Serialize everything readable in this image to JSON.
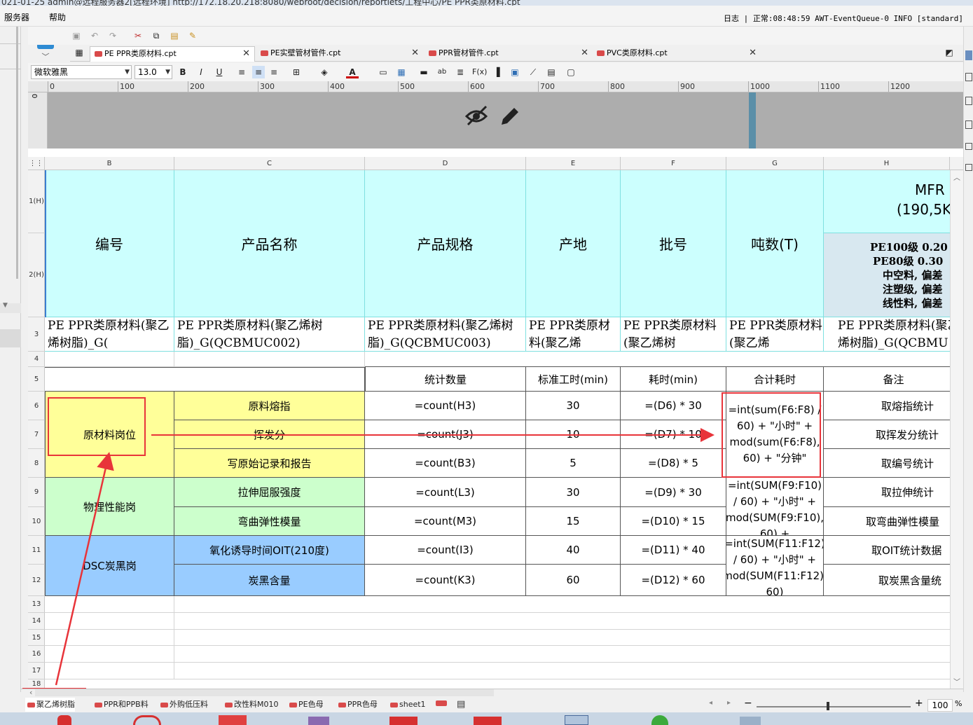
{
  "window": {
    "title_fragment": "021-01-25 admin@远程服务器2[远程环境]    http://172.18.20.218:8080/webroot/decision/reportlets/工程中心/PE PPR类原材料.cpt"
  },
  "menu": {
    "items": [
      "服务器",
      "帮助"
    ]
  },
  "status": {
    "text": "日志 | 正常:08:48:59 AWT-EventQueue-0 INFO [standard] "
  },
  "tabs": [
    {
      "label": "PE PPR类原材料.cpt",
      "active": true
    },
    {
      "label": "PE实壁管材管件.cpt",
      "active": false
    },
    {
      "label": "PPR管材管件.cpt",
      "active": false
    },
    {
      "label": "PVC类原材料.cpt",
      "active": false
    }
  ],
  "format": {
    "font_name": "微软雅黑",
    "font_size": "13.0"
  },
  "ruler": {
    "labels": [
      "0",
      "100",
      "200",
      "300",
      "400",
      "500",
      "600",
      "700",
      "800",
      "900",
      "1000",
      "1100",
      "1200"
    ]
  },
  "columns": [
    "B",
    "C",
    "D",
    "E",
    "F",
    "G",
    "H"
  ],
  "rows": {
    "heights_labels": [
      "1(H)",
      "2(H)",
      "3",
      "4",
      "5",
      "6",
      "7",
      "8",
      "9",
      "10",
      "11",
      "12",
      "13",
      "14",
      "15",
      "16",
      "17",
      "18"
    ]
  },
  "header": {
    "b": "编号",
    "c": "产品名称",
    "d": "产品规格",
    "e": "产地",
    "f": "批号",
    "g": "吨数(T)",
    "h_top_line1": "MFR",
    "h_top_line2": "(190,5K",
    "h_sub": [
      "PE100级 0.20",
      "PE80级 0.30",
      "中空料, 偏差",
      "注塑级, 偏差",
      "线性料, 偏差"
    ]
  },
  "row3": {
    "b": "PE  PPR类原材料(聚乙烯树脂)_G(",
    "c": "PE  PPR类原材料(聚乙烯树脂)_G(QCBMUC002)",
    "d": "PE  PPR类原材料(聚乙烯树脂)_G(QCBMUC003)",
    "e": "PE  PPR类原材料(聚乙烯",
    "f": "PE  PPR类原材料(聚乙烯树",
    "g": "PE  PPR类原材料(聚乙烯",
    "h": "PE  PPR类原材料(聚乙烯树脂)_G(QCBMU"
  },
  "row5": {
    "d": "统计数量",
    "e": "标准工时(min)",
    "f": "耗时(min)",
    "g": "合计耗时",
    "h": "备注"
  },
  "groups": [
    {
      "label": "原材料岗位"
    },
    {
      "label": "物理性能岗"
    },
    {
      "label": "DSC炭黑岗"
    }
  ],
  "items": [
    {
      "name": "原料熔指",
      "count": "=count(H3)",
      "std": "30",
      "cost": "=(D6) * 30",
      "note": "取熔指统计"
    },
    {
      "name": "挥发分",
      "count": "=count(J3)",
      "std": "10",
      "cost": "=(D7) * 10",
      "note": "取挥发分统计"
    },
    {
      "name": "写原始记录和报告",
      "count": "=count(B3)",
      "std": "5",
      "cost": "=(D8) * 5",
      "note": "取编号统计"
    },
    {
      "name": "拉伸屈服强度",
      "count": "=count(L3)",
      "std": "30",
      "cost": "=(D9) * 30",
      "note": "取拉伸统计"
    },
    {
      "name": "弯曲弹性模量",
      "count": "=count(M3)",
      "std": "15",
      "cost": "=(D10) * 15",
      "note": "取弯曲弹性模量"
    },
    {
      "name": "氧化诱导时间OIT(210度)",
      "count": "=count(I3)",
      "std": "40",
      "cost": "=(D11) * 40",
      "note": "取OIT统计数据"
    },
    {
      "name": "炭黑含量",
      "count": "=count(K3)",
      "std": "60",
      "cost": "=(D12) * 60",
      "note": "取炭黑含量统"
    }
  ],
  "totals": {
    "g6": "=int(sum(F6:F8) / 60) + \"小时\" + mod(sum(F6:F8), 60) + \"分钟\"",
    "g9": "=int(SUM(F9:F10) / 60) + \"小时\" + mod(SUM(F9:F10), 60) +",
    "g11": "=int(SUM(F11:F12) / 60) + \"小时\" + mod(SUM(F11:F12), 60)"
  },
  "sheets": [
    "聚乙烯树脂",
    "PPR和PPB料",
    "外购低压料",
    "改性料M010",
    "PE色母",
    "PPR色母",
    "sheet1"
  ],
  "zoom": "100",
  "colors": {
    "header_bg": "#ccfffe",
    "yellow": "#ffff99",
    "green": "#ccffcc",
    "blue": "#99ccff",
    "annotation": "#e8343a"
  }
}
